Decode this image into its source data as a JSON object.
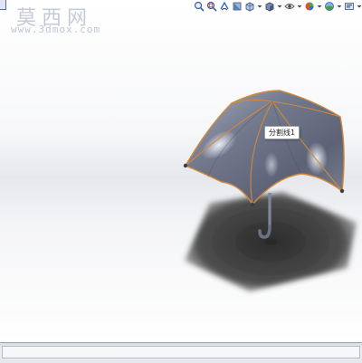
{
  "watermark": {
    "title": "莫西网",
    "url": "www.3dmox.com"
  },
  "feature_callout": {
    "label": "分割线1"
  },
  "heads_up_toolbar": {
    "tools": [
      {
        "name": "zoom-to-fit",
        "icon": "zoom-fit-icon"
      },
      {
        "name": "zoom-to-area",
        "icon": "zoom-area-icon"
      },
      {
        "name": "previous-view",
        "icon": "previous-view-icon"
      },
      {
        "name": "section-view",
        "icon": "section-view-icon"
      },
      {
        "name": "view-orientation",
        "icon": "view-orientation-icon",
        "dropdown": true
      },
      {
        "name": "display-style",
        "icon": "display-style-icon",
        "dropdown": true
      },
      {
        "name": "hide-show-items",
        "icon": "hide-show-icon",
        "dropdown": true
      },
      {
        "name": "edit-appearance",
        "icon": "appearance-icon",
        "dropdown": true
      },
      {
        "name": "apply-scene",
        "icon": "scene-icon",
        "dropdown": true
      },
      {
        "name": "view-settings",
        "icon": "view-settings-icon",
        "dropdown": true
      }
    ]
  },
  "colors": {
    "umbrella_body": "#6f7386",
    "umbrella_highlight": "#dfe3ee",
    "silhouette_edge": "#d0893c",
    "handle": "#7f8799",
    "shadow": "#3a3a3a",
    "accent_blue": "#2f6fd0"
  }
}
